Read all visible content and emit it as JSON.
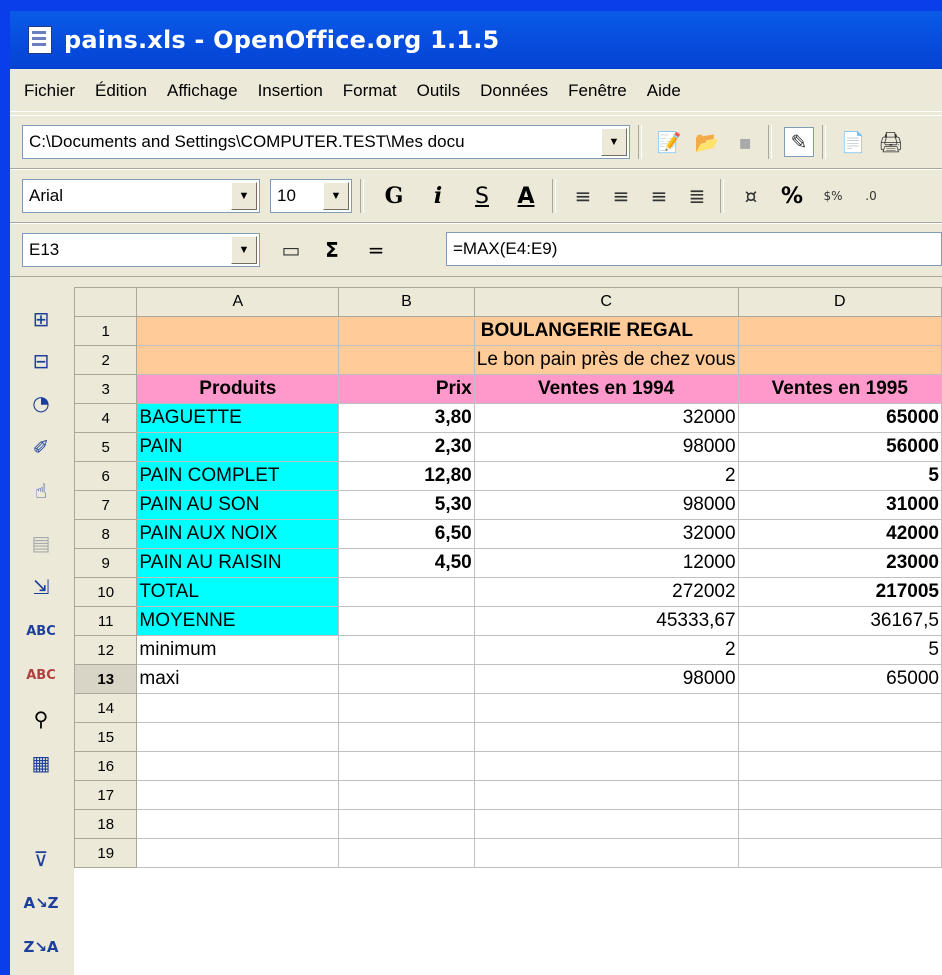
{
  "window": {
    "title": "pains.xls - OpenOffice.org 1.1.5"
  },
  "menu": [
    {
      "label": "Fichier"
    },
    {
      "label": "Édition"
    },
    {
      "label": "Affichage"
    },
    {
      "label": "Insertion"
    },
    {
      "label": "Format"
    },
    {
      "label": "Outils"
    },
    {
      "label": "Données"
    },
    {
      "label": "Fenêtre"
    },
    {
      "label": "Aide"
    }
  ],
  "toolbar": {
    "url": "C:\\Documents and Settings\\COMPUTER.TEST\\Mes docu",
    "font_name": "Arial",
    "font_size": "10",
    "bold_label": "G",
    "italic_label": "i",
    "underline_label": "S",
    "percent_label": "%"
  },
  "formula_bar": {
    "cell_ref": "E13",
    "sum_label": "Σ",
    "equals_label": "=",
    "formula": "=MAX(E4:E9)"
  },
  "sheet": {
    "columns": [
      "A",
      "B",
      "C",
      "D"
    ],
    "row_numbers": [
      "1",
      "2",
      "3",
      "4",
      "5",
      "6",
      "7",
      "8",
      "9",
      "10",
      "11",
      "12",
      "13",
      "14",
      "15",
      "16",
      "17",
      "18",
      "19"
    ],
    "title": "BOULANGERIE REGAL",
    "subtitle": "Le bon pain près de chez vous",
    "headers": [
      "Produits",
      "Prix",
      "Ventes en 1994",
      "Ventes en 1995"
    ],
    "rows": [
      {
        "a": "BAGUETTE",
        "b": "3,80",
        "c": "32000",
        "d": "65000"
      },
      {
        "a": "PAIN",
        "b": "2,30",
        "c": "98000",
        "d": "56000"
      },
      {
        "a": "PAIN COMPLET",
        "b": "12,80",
        "c": "2",
        "d": "5"
      },
      {
        "a": "PAIN AU SON",
        "b": "5,30",
        "c": "98000",
        "d": "31000"
      },
      {
        "a": "PAIN AUX NOIX",
        "b": "6,50",
        "c": "32000",
        "d": "42000"
      },
      {
        "a": "PAIN AU RAISIN",
        "b": "4,50",
        "c": "12000",
        "d": "23000"
      },
      {
        "a": "TOTAL",
        "b": "",
        "c": "272002",
        "d": "217005"
      },
      {
        "a": "MOYENNE",
        "b": "",
        "c": "45333,67",
        "d": "36167,5"
      },
      {
        "a": "minimum",
        "b": "",
        "c": "2",
        "d": "5"
      },
      {
        "a": "maxi",
        "b": "",
        "c": "98000",
        "d": "65000"
      }
    ]
  }
}
